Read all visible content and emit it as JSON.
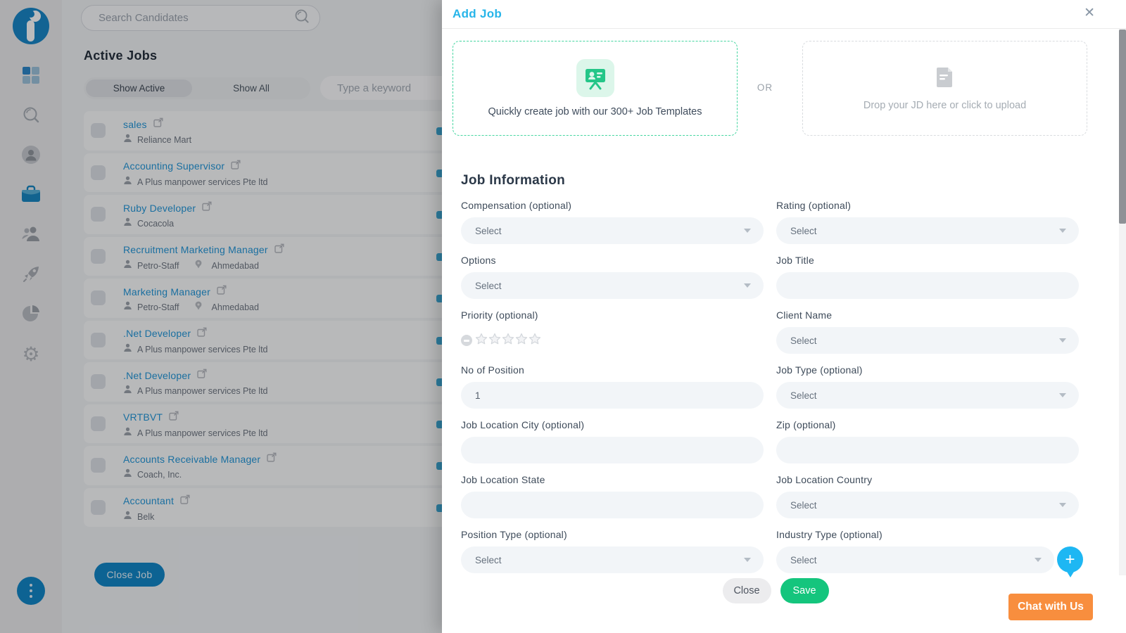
{
  "colors": {
    "brand_blue": "#0f86c6",
    "link_blue": "#2196d8",
    "modal_title_cyan": "#27b5e9",
    "template_teal": "#45d6a0",
    "template_green": "#24c688",
    "save_green": "#14c57d",
    "chat_orange": "#f88e3e",
    "fab_cyan": "#1eb7f3",
    "field_bg": "#f2f5f8"
  },
  "sidebar": {
    "icon_names": [
      "dashboard",
      "search",
      "candidates",
      "jobs-briefcase",
      "clients",
      "boost-rocket",
      "reports-pie",
      "settings-gear"
    ],
    "active_item": "jobs-briefcase"
  },
  "panel": {
    "search_placeholder": "Search Candidates",
    "title": "Active Jobs",
    "tab_active": "Show Active",
    "tab_all": "Show All",
    "keyword_placeholder": "Type a keyword",
    "close_job_label": "Close Job",
    "jobs": [
      {
        "title": "sales",
        "company": "Reliance Mart"
      },
      {
        "title": "Accounting Supervisor",
        "company": "A Plus manpower services Pte ltd"
      },
      {
        "title": "Ruby Developer",
        "company": "Cocacola"
      },
      {
        "title": "Recruitment Marketing Manager",
        "company": "Petro-Staff",
        "location": "Ahmedabad"
      },
      {
        "title": "Marketing Manager",
        "company": "Petro-Staff",
        "location": "Ahmedabad"
      },
      {
        "title": ".Net Developer",
        "company": "A Plus manpower services Pte ltd"
      },
      {
        "title": ".Net Developer",
        "company": "A Plus manpower services Pte ltd"
      },
      {
        "title": "VRTBVT",
        "company": "A Plus manpower services Pte ltd"
      },
      {
        "title": "Accounts Receivable Manager",
        "company": "Coach, Inc."
      },
      {
        "title": "Accountant",
        "company": "Belk"
      }
    ]
  },
  "modal": {
    "title": "Add Job",
    "close_glyph": "✕",
    "template_text": "Quickly create job with our 300+ Job Templates",
    "or_label": "OR",
    "drop_text": "Drop your JD here or click to upload",
    "section_title": "Job Information",
    "left_fields": [
      {
        "label": "Compensation (optional)",
        "type": "select",
        "value": "Select"
      },
      {
        "label": "Options",
        "type": "select",
        "value": "Select"
      },
      {
        "label": "Priority (optional)",
        "type": "stars",
        "value": ""
      },
      {
        "label": "No of Position",
        "type": "input",
        "value": "1"
      },
      {
        "label": "Job Location City (optional)",
        "type": "input",
        "value": ""
      },
      {
        "label": "Job Location State",
        "type": "input",
        "value": ""
      },
      {
        "label": "Position Type (optional)",
        "type": "select",
        "value": "Select"
      }
    ],
    "right_fields": [
      {
        "label": "Rating (optional)",
        "type": "select",
        "value": "Select"
      },
      {
        "label": "Job Title",
        "type": "input",
        "value": ""
      },
      {
        "label": "Client Name",
        "type": "select",
        "value": "Select"
      },
      {
        "label": "Job Type (optional)",
        "type": "select",
        "value": "Select"
      },
      {
        "label": "Zip (optional)",
        "type": "input",
        "value": ""
      },
      {
        "label": "Job Location Country",
        "type": "select",
        "value": "Select"
      },
      {
        "label": "Industry Type (optional)",
        "type": "select",
        "value": "Select"
      }
    ],
    "footer": {
      "close_label": "Close",
      "save_label": "Save"
    }
  },
  "fab": {
    "plus_glyph": "+"
  },
  "chat": {
    "label": "Chat with Us"
  }
}
